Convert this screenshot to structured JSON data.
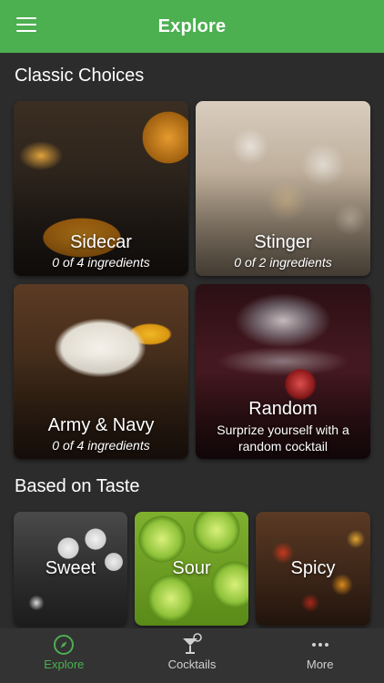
{
  "header": {
    "title": "Explore"
  },
  "classic": {
    "title": "Classic Choices",
    "cards": [
      {
        "name": "Sidecar",
        "detail": "0 of 4 ingredients"
      },
      {
        "name": "Stinger",
        "detail": "0 of 2 ingredients"
      },
      {
        "name": "Army & Navy",
        "detail": "0 of 4 ingredients"
      },
      {
        "name": "Random",
        "detail": "Surprize yourself with a random cocktail"
      }
    ]
  },
  "taste": {
    "title": "Based on Taste",
    "cards": [
      {
        "name": "Sweet"
      },
      {
        "name": "Sour"
      },
      {
        "name": "Spicy"
      }
    ]
  },
  "nav": {
    "tabs": [
      {
        "label": "Explore",
        "icon": "compass-icon",
        "active": true
      },
      {
        "label": "Cocktails",
        "icon": "cocktail-glass-icon",
        "active": false
      },
      {
        "label": "More",
        "icon": "more-dots-icon",
        "active": false
      }
    ]
  },
  "colors": {
    "primary": "#4caf50",
    "background": "#2c2c2c",
    "bottom_bar": "#333333"
  }
}
